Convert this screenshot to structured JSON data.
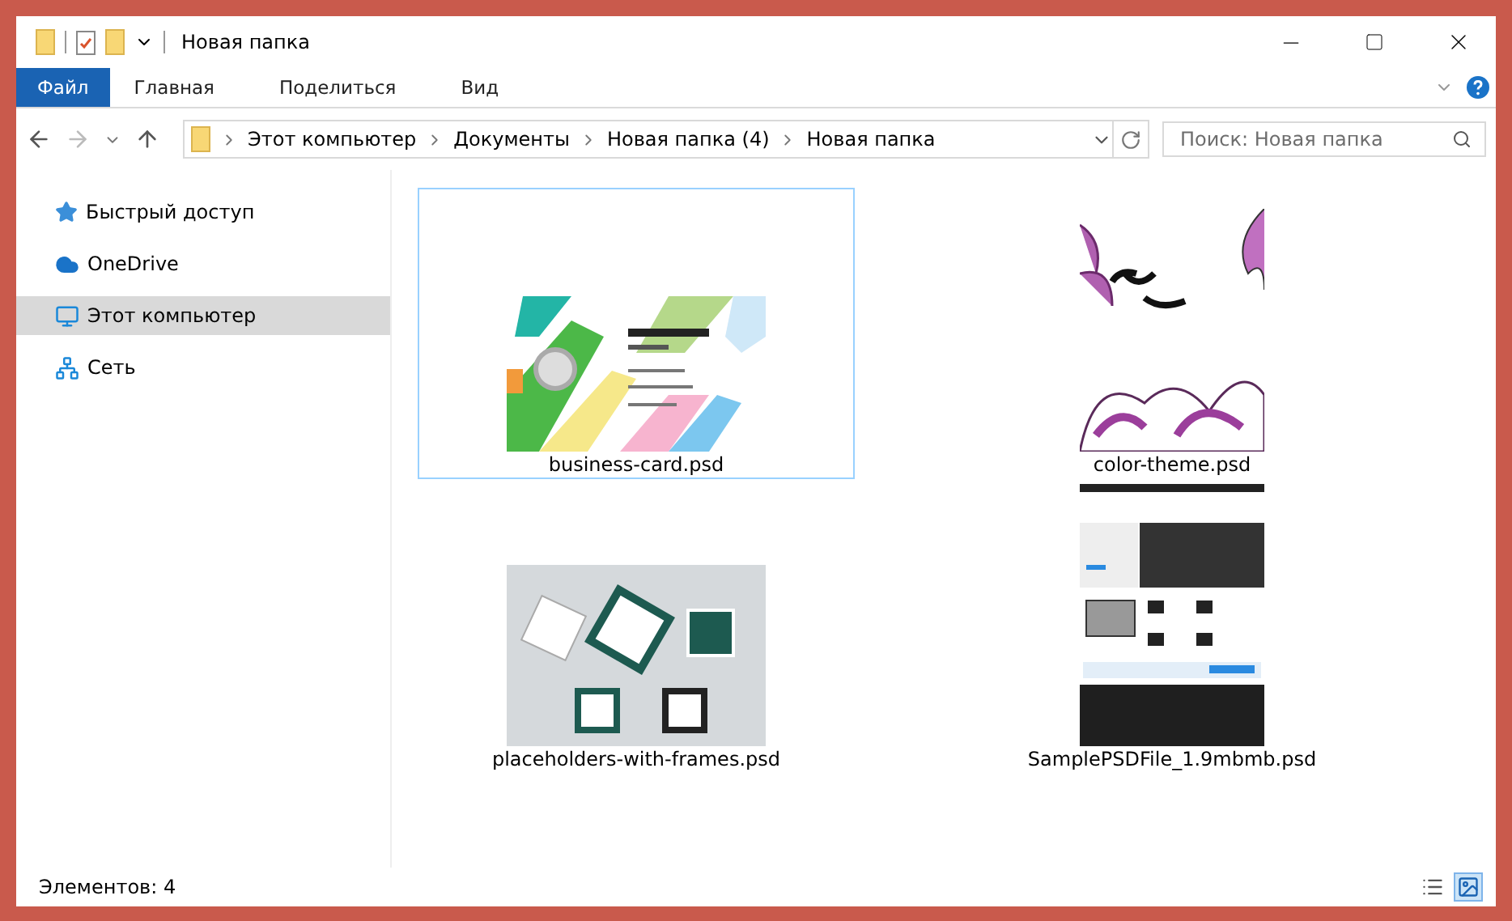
{
  "window": {
    "title": "Новая папка"
  },
  "ribbon_tabs": [
    {
      "label": "Файл",
      "kind": "file"
    },
    {
      "label": "Главная",
      "kind": "tab"
    },
    {
      "label": "Поделиться",
      "kind": "tab"
    },
    {
      "label": "Вид",
      "kind": "tab"
    }
  ],
  "breadcrumb": [
    "Этот компьютер",
    "Документы",
    "Новая папка (4)",
    "Новая папка"
  ],
  "search": {
    "placeholder": "Поиск: Новая папка"
  },
  "sidebar": {
    "items": [
      {
        "label": "Быстрый доступ",
        "kind": "star",
        "selected": false
      },
      {
        "label": "OneDrive",
        "kind": "cloud",
        "selected": false
      },
      {
        "label": "Этот компьютер",
        "kind": "computer",
        "selected": true
      },
      {
        "label": "Сеть",
        "kind": "network",
        "selected": false
      }
    ]
  },
  "files": [
    {
      "name": "business-card.psd",
      "kind": "card",
      "selected": true
    },
    {
      "name": "color-theme.psd",
      "kind": "floral",
      "selected": false
    },
    {
      "name": "placeholders-with-frames.psd",
      "kind": "frames",
      "selected": false
    },
    {
      "name": "SamplePSDFile_1.9mbmb.psd",
      "kind": "website",
      "selected": false
    }
  ],
  "status_bar": {
    "text": "Элементов: 4",
    "views": [
      {
        "kind": "details",
        "selected": false
      },
      {
        "kind": "large",
        "selected": true
      }
    ]
  }
}
